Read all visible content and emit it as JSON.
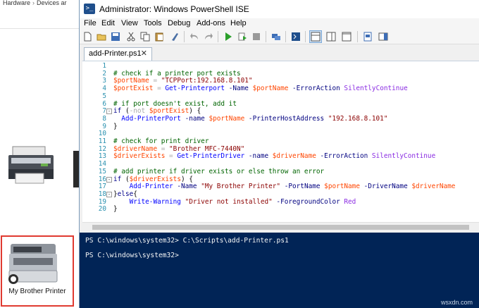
{
  "explorer": {
    "breadcrumb": [
      "Hardware",
      "Devices ar"
    ],
    "selected_printer_label": "My Brother Printer"
  },
  "window": {
    "title": "Administrator: Windows PowerShell ISE",
    "app_icon_glyph": ">_"
  },
  "menu": [
    "File",
    "Edit",
    "View",
    "Tools",
    "Debug",
    "Add-ons",
    "Help"
  ],
  "toolbar_icons": [
    "new-file-icon",
    "open-folder-icon",
    "save-icon",
    "cut-icon",
    "copy-icon",
    "paste-icon",
    "clear-console-icon",
    "undo-icon",
    "redo-icon",
    "run-script-icon",
    "run-selection-icon",
    "stop-icon",
    "remote-tab-icon",
    "start-powershell-icon",
    "show-script-pane-top-icon",
    "show-script-pane-right-icon",
    "show-script-pane-max-icon",
    "show-command-window-icon",
    "show-addon-tools-icon"
  ],
  "tab": {
    "label": "add-Printer.ps1",
    "close": "✕"
  },
  "editor": {
    "lines": [
      {
        "num": "1",
        "tokens": []
      },
      {
        "num": "2",
        "tokens": [
          {
            "t": "# check if a printer port exists",
            "c": "c-com"
          }
        ]
      },
      {
        "num": "3",
        "tokens": [
          {
            "t": "$portName",
            "c": "c-var"
          },
          {
            "t": " = ",
            "c": "c-op"
          },
          {
            "t": "\"TCPPort:192.168.8.101\"",
            "c": "c-str"
          }
        ]
      },
      {
        "num": "4",
        "tokens": [
          {
            "t": "$portExist",
            "c": "c-var"
          },
          {
            "t": " = ",
            "c": "c-op"
          },
          {
            "t": "Get-Printerport",
            "c": "c-cmd"
          },
          {
            "t": " -Name ",
            "c": "c-par"
          },
          {
            "t": "$portName",
            "c": "c-var"
          },
          {
            "t": " -ErrorAction ",
            "c": "c-par"
          },
          {
            "t": "SilentlyContinue",
            "c": "c-arg"
          }
        ]
      },
      {
        "num": "5",
        "tokens": []
      },
      {
        "num": "6",
        "tokens": [
          {
            "t": "# if port doesn't exist, add it",
            "c": "c-com"
          }
        ]
      },
      {
        "num": "7",
        "fold": "⊟",
        "tokens": [
          {
            "t": "if",
            "c": "c-kw"
          },
          {
            "t": " (",
            "c": "c-plain"
          },
          {
            "t": "-not",
            "c": "c-op"
          },
          {
            "t": " ",
            "c": "c-plain"
          },
          {
            "t": "$portExist",
            "c": "c-var"
          },
          {
            "t": ") {",
            "c": "c-plain"
          }
        ]
      },
      {
        "num": "8",
        "tokens": [
          {
            "t": "  Add-PrinterPort",
            "c": "c-cmd"
          },
          {
            "t": " -name ",
            "c": "c-par"
          },
          {
            "t": "$portName",
            "c": "c-var"
          },
          {
            "t": " -PrinterHostAddress ",
            "c": "c-par"
          },
          {
            "t": "\"192.168.8.101\"",
            "c": "c-str"
          }
        ]
      },
      {
        "num": "9",
        "tokens": [
          {
            "t": "}",
            "c": "c-plain"
          }
        ]
      },
      {
        "num": "10",
        "tokens": []
      },
      {
        "num": "11",
        "tokens": [
          {
            "t": "# check for print driver",
            "c": "c-com"
          }
        ]
      },
      {
        "num": "12",
        "tokens": [
          {
            "t": "$driverName",
            "c": "c-var"
          },
          {
            "t": " = ",
            "c": "c-op"
          },
          {
            "t": "\"Brother MFC-7440N\"",
            "c": "c-str"
          }
        ]
      },
      {
        "num": "13",
        "tokens": [
          {
            "t": "$driverExists",
            "c": "c-var"
          },
          {
            "t": " = ",
            "c": "c-op"
          },
          {
            "t": "Get-PrinterDriver",
            "c": "c-cmd"
          },
          {
            "t": " -name ",
            "c": "c-par"
          },
          {
            "t": "$driverName",
            "c": "c-var"
          },
          {
            "t": " -ErrorAction ",
            "c": "c-par"
          },
          {
            "t": "SilentlyContinue",
            "c": "c-arg"
          }
        ]
      },
      {
        "num": "14",
        "tokens": []
      },
      {
        "num": "15",
        "tokens": [
          {
            "t": "# add printer if driver exists or else throw an error",
            "c": "c-com"
          }
        ]
      },
      {
        "num": "16",
        "fold": "⊟",
        "tokens": [
          {
            "t": "if",
            "c": "c-kw"
          },
          {
            "t": " (",
            "c": "c-plain"
          },
          {
            "t": "$driverExists",
            "c": "c-var"
          },
          {
            "t": ") {",
            "c": "c-plain"
          }
        ]
      },
      {
        "num": "17",
        "tokens": [
          {
            "t": "    Add-Printer",
            "c": "c-cmd"
          },
          {
            "t": " -Name ",
            "c": "c-par"
          },
          {
            "t": "\"My Brother Printer\"",
            "c": "c-str"
          },
          {
            "t": " -PortName ",
            "c": "c-par"
          },
          {
            "t": "$portName",
            "c": "c-var"
          },
          {
            "t": " -DriverName ",
            "c": "c-par"
          },
          {
            "t": "$driverName",
            "c": "c-var"
          }
        ]
      },
      {
        "num": "18",
        "fold": "⊟",
        "tokens": [
          {
            "t": "}",
            "c": "c-plain"
          },
          {
            "t": "else",
            "c": "c-kw"
          },
          {
            "t": "{",
            "c": "c-plain"
          }
        ]
      },
      {
        "num": "19",
        "tokens": [
          {
            "t": "    Write-Warning",
            "c": "c-cmd"
          },
          {
            "t": " \"Driver not installed\"",
            "c": "c-str"
          },
          {
            "t": " -ForegroundColor ",
            "c": "c-par"
          },
          {
            "t": "Red",
            "c": "c-arg"
          }
        ]
      },
      {
        "num": "20",
        "tokens": [
          {
            "t": "}",
            "c": "c-plain"
          }
        ]
      }
    ]
  },
  "console": {
    "lines": [
      "PS C:\\windows\\system32> C:\\Scripts\\add-Printer.ps1",
      "",
      "PS C:\\windows\\system32>"
    ]
  },
  "colors": {
    "console_bg": "#012456",
    "selection_border": "#e03a30",
    "comment": "#006400",
    "variable": "#ff4500",
    "string": "#8b0000",
    "command": "#0000ff"
  },
  "watermark": "wsxdn.com"
}
